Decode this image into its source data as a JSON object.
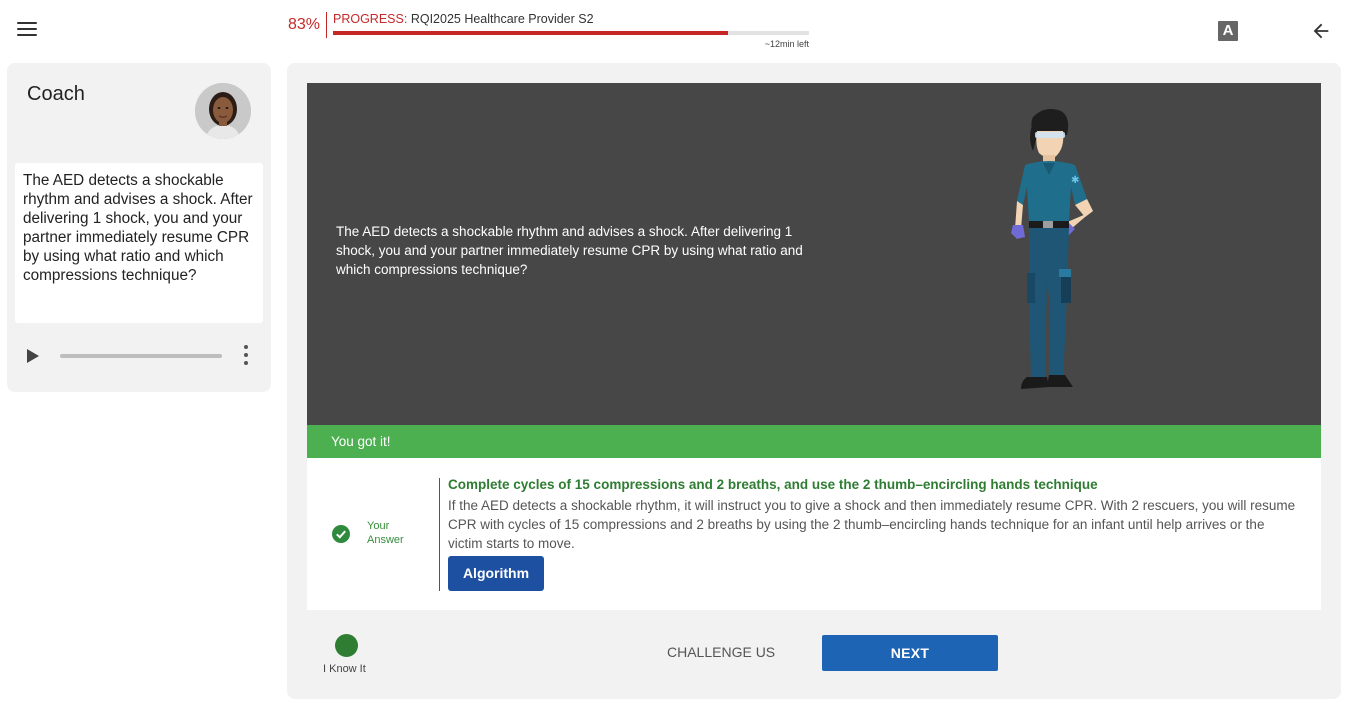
{
  "header": {
    "progress_percent_text": "83%",
    "progress_fraction": 0.83,
    "progress_label_prefix": "PROGRESS:",
    "progress_label_course": "RQI2025 Healthcare Provider S2",
    "time_left": "~12min left",
    "font_toggle_label": "A"
  },
  "coach": {
    "title": "Coach",
    "message": "The AED detects a shockable rhythm and advises a shock. After delivering 1 shock, you and your partner immediately resume CPR by using what ratio and which compressions technique?"
  },
  "scene": {
    "question": "The AED detects a shockable rhythm and advises a shock. After delivering 1 shock, you and your partner immediately resume CPR by using what ratio and which compressions technique?"
  },
  "result": {
    "banner": "You got it!",
    "your_answer_label": "Your Answer",
    "answer_title": "Complete cycles of 15 compressions and 2 breaths, and use the 2 thumb–encircling hands technique",
    "answer_explanation": "If the AED detects a shockable rhythm, it will instruct you to give a shock and then immediately resume CPR. With 2 rescuers, you will resume CPR with cycles of 15 compressions and 2 breaths by using the 2 thumb–encircling hands technique for an infant until help arrives or the victim starts to move.",
    "algorithm_button": "Algorithm"
  },
  "footer": {
    "know_it_label": "I Know It",
    "challenge_label": "CHALLENGE US",
    "next_label": "NEXT"
  },
  "colors": {
    "accent_red": "#c62828",
    "success_green": "#4caf50",
    "answer_green": "#2e7d32",
    "primary_blue": "#1e64b4",
    "scene_bg": "#474747"
  }
}
